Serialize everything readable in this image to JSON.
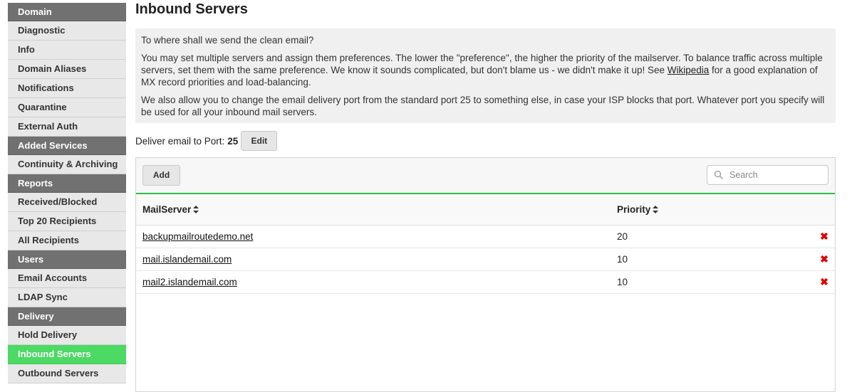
{
  "sidebar": [
    {
      "type": "section",
      "label": "Domain"
    },
    {
      "type": "item",
      "label": "Diagnostic"
    },
    {
      "type": "item",
      "label": "Info"
    },
    {
      "type": "item",
      "label": "Domain Aliases"
    },
    {
      "type": "item",
      "label": "Notifications"
    },
    {
      "type": "item",
      "label": "Quarantine"
    },
    {
      "type": "item",
      "label": "External Auth"
    },
    {
      "type": "section",
      "label": "Added Services"
    },
    {
      "type": "item",
      "label": "Continuity & Archiving"
    },
    {
      "type": "section",
      "label": "Reports"
    },
    {
      "type": "item",
      "label": "Received/Blocked"
    },
    {
      "type": "item",
      "label": "Top 20 Recipients"
    },
    {
      "type": "item",
      "label": "All Recipients"
    },
    {
      "type": "section",
      "label": "Users"
    },
    {
      "type": "item",
      "label": "Email Accounts"
    },
    {
      "type": "item",
      "label": "LDAP Sync"
    },
    {
      "type": "section",
      "label": "Delivery"
    },
    {
      "type": "item",
      "label": "Hold Delivery"
    },
    {
      "type": "item",
      "label": "Inbound Servers",
      "active": true
    },
    {
      "type": "item",
      "label": "Outbound Servers"
    }
  ],
  "page": {
    "title": "Inbound Servers",
    "info": {
      "question": "To where shall we send the clean email?",
      "para2_before": "You may set multiple servers and assign them preferences. The lower the \"preference\", the higher the priority of the mailserver. To balance traffic across multiple servers, set them with the same preference. We know it sounds complicated, but don't blame us - we didn't make it up! See ",
      "para2_link": "Wikipedia",
      "para2_after": " for a good explanation of MX record priorities and load-balancing.",
      "para3": "We also allow you to change the email delivery port from the standard port 25 to something else, in case your ISP blocks that port. Whatever port you specify will be used for all your inbound mail servers."
    },
    "port": {
      "label": "Deliver email to Port:",
      "value": "25",
      "edit_label": "Edit"
    },
    "toolbar": {
      "add_label": "Add",
      "search_placeholder": "Search"
    },
    "table": {
      "columns": [
        "MailServer",
        "Priority"
      ],
      "rows": [
        {
          "server": "backupmailroutedemo.net",
          "priority": "20"
        },
        {
          "server": "mail.islandemail.com",
          "priority": "10"
        },
        {
          "server": "mail2.islandemail.com",
          "priority": "10"
        }
      ]
    }
  },
  "colors": {
    "accent_green": "#4cd964",
    "section_gray": "#717171",
    "delete_red": "#e00000"
  }
}
